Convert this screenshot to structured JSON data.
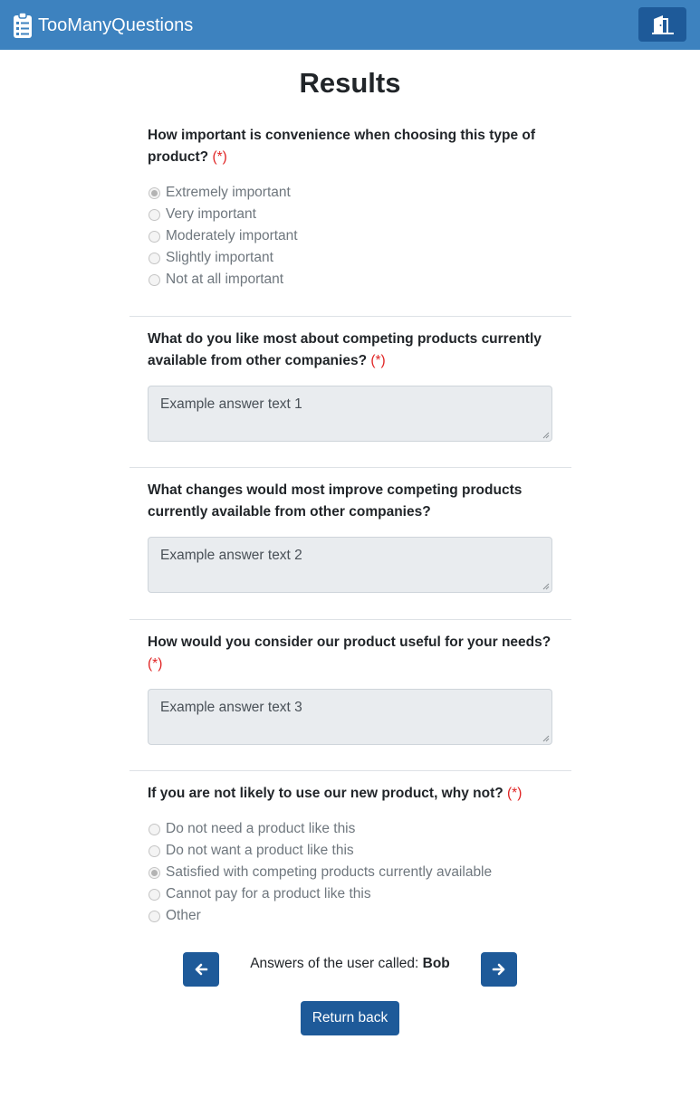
{
  "navbar": {
    "brand": "TooManyQuestions",
    "brand_icon": "clipboard-list-icon",
    "logout_icon": "door-exit-icon",
    "color": "#3d82bf"
  },
  "page": {
    "title": "Results"
  },
  "required_marker": "(*)",
  "q1": {
    "text": "How important is convenience when choosing this type of product?",
    "required": true,
    "options": [
      "Extremely important",
      "Very important",
      "Moderately important",
      "Slightly important",
      "Not at all important"
    ],
    "selected": "Extremely important"
  },
  "q2": {
    "text": "What do you like most about competing products currently available from other companies?",
    "required": true,
    "answer": "Example answer text 1"
  },
  "q3": {
    "text": "What changes would most improve competing products currently available from other companies?",
    "required": false,
    "answer": "Example answer text 2"
  },
  "q4": {
    "text": "How would you consider our product useful for your needs?",
    "required": true,
    "answer": "Example answer text 3"
  },
  "q5": {
    "text": "If you are not likely to use our new product, why not?",
    "required": true,
    "options": [
      "Do not need a product like this",
      "Do not want a product like this",
      "Satisfied with competing products currently available",
      "Cannot pay for a product like this",
      "Other"
    ],
    "selected": "Satisfied with competing products currently available"
  },
  "pager": {
    "caption_prefix": "Answers of the user called: ",
    "user_name": "Bob",
    "prev_icon": "arrow-left-icon",
    "next_icon": "arrow-right-icon"
  },
  "actions": {
    "return_label": "Return back"
  },
  "colors": {
    "button": "#1e5a99",
    "required": "#e02424"
  }
}
